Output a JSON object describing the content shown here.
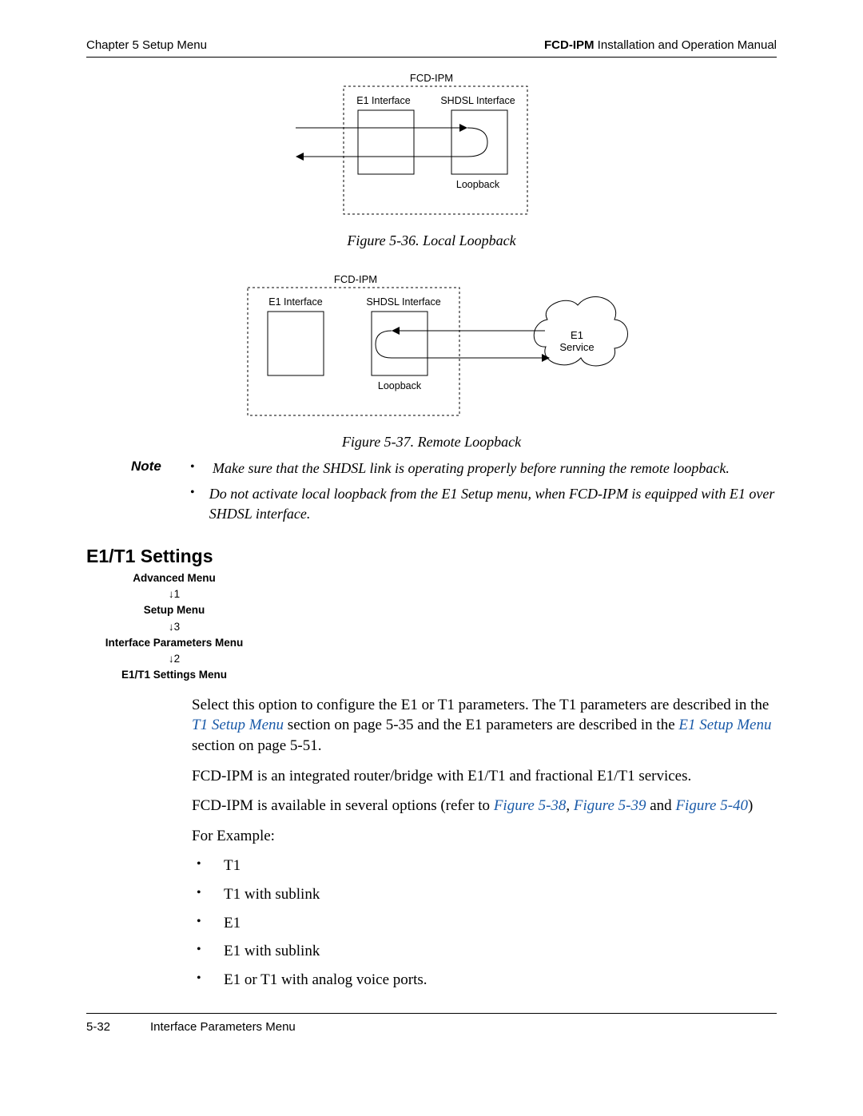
{
  "header": {
    "left": "Chapter 5  Setup Menu",
    "right_bold": "FCD-IPM",
    "right_rest": " Installation and Operation Manual"
  },
  "fig36": {
    "top_label": "FCD-IPM",
    "e1": "E1 Interface",
    "shdsl": "SHDSL Interface",
    "loopback": "Loopback",
    "caption": "Figure 5-36.  Local Loopback"
  },
  "fig37": {
    "top_label": "FCD-IPM",
    "e1": "E1 Interface",
    "shdsl": "SHDSL Interface",
    "loopback": "Loopback",
    "cloud": "E1\nService",
    "caption": "Figure 5-37.  Remote Loopback"
  },
  "note": {
    "label": "Note",
    "items": [
      "Make sure that the SHDSL link is operating properly before running the remote loopback.",
      "Do not activate local loopback from the E1 Setup menu, when FCD-IPM is equipped with E1 over SHDSL interface."
    ]
  },
  "section": {
    "heading": "E1/T1 Settings",
    "crumb": [
      "Advanced Menu",
      "↓1",
      "Setup Menu",
      "↓3",
      "Interface Parameters Menu",
      "↓2",
      "E1/T1 Settings Menu"
    ]
  },
  "body": {
    "p1a": "Select this option to configure the E1 or T1 parameters. The T1 parameters are described in the ",
    "p1_link1": "T1 Setup Menu",
    "p1b": " section on page 5-35 and the E1 parameters are described in the ",
    "p1_link2": "E1 Setup Menu",
    "p1c": " section on page 5-51.",
    "p2": "FCD-IPM is an integrated router/bridge with E1/T1 and fractional E1/T1 services.",
    "p3a": "FCD-IPM is available in several options (refer to ",
    "p3_link1": "Figure 5-38",
    "p3b": ", ",
    "p3_link2": "Figure 5-39",
    "p3c": " and ",
    "p3_link3": "Figure 5-40",
    "p3d": ")",
    "p4": "For Example:",
    "examples": [
      "T1",
      "T1 with sublink",
      "E1",
      "E1 with sublink",
      "E1 or T1 with analog voice ports."
    ]
  },
  "footer": {
    "page": "5-32",
    "title": "Interface Parameters Menu"
  }
}
